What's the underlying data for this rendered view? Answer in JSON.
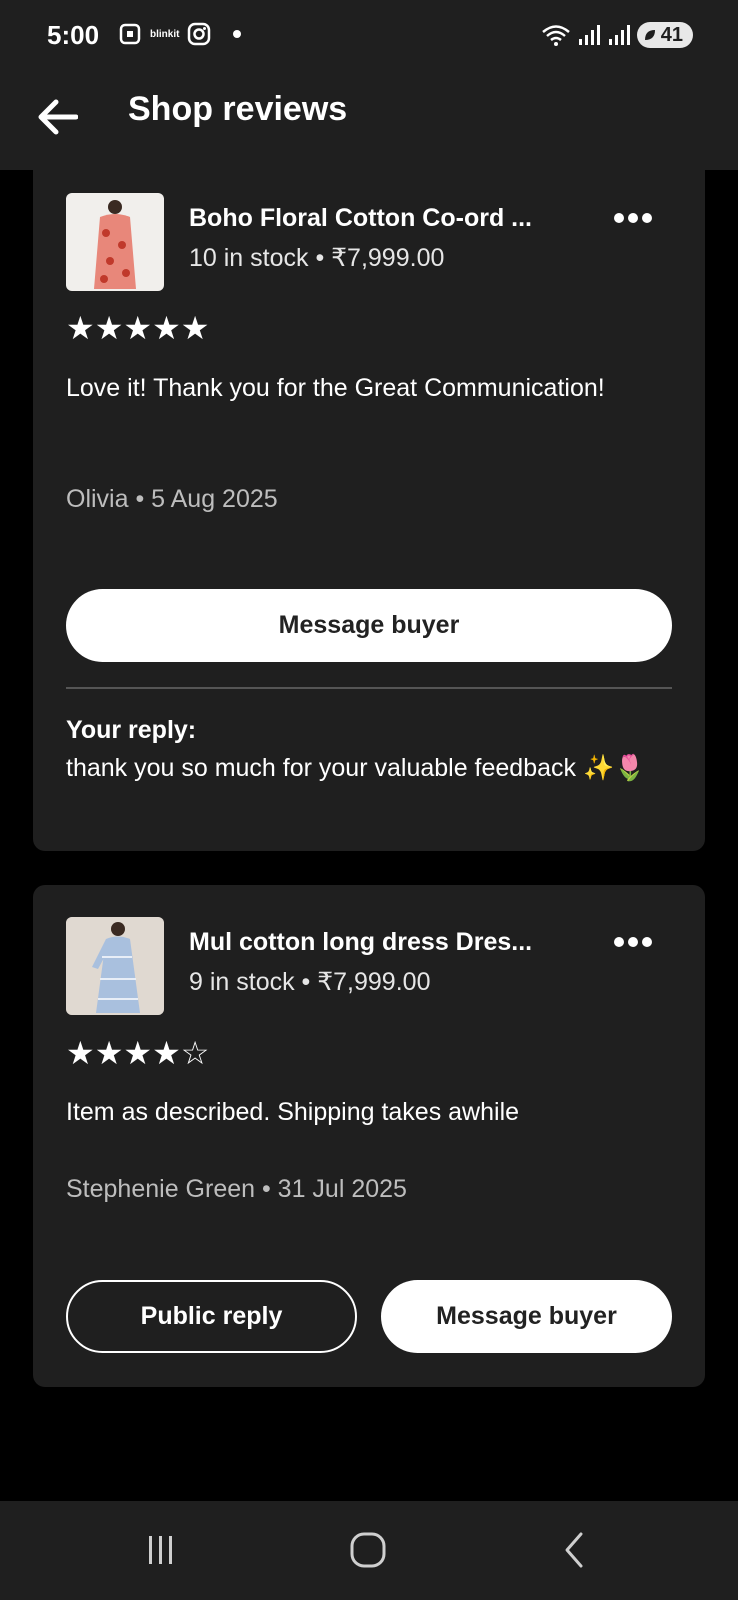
{
  "status_bar": {
    "time": "5:00",
    "blinkit": "blinkit",
    "battery": "41",
    "icons": [
      "screenshot-icon",
      "instagram-icon",
      "wifi-icon",
      "signal-icon",
      "signal-icon",
      "battery-saver-icon"
    ]
  },
  "app_bar": {
    "title": "Shop reviews",
    "back_icon": "arrow-left-icon"
  },
  "reviews": [
    {
      "product_title": "Boho Floral Cotton Co-ord ...",
      "product_meta": "10 in stock • ₹7,999.00",
      "rating": 5,
      "stars_text": "★★★★★",
      "text": "Love it! Thank you for the Great Communication!",
      "reviewer": "Olivia • 5 Aug 2025",
      "message_button": "Message buyer",
      "reply_label": "Your reply:",
      "reply_text": "thank you so much for your valuable  feedback ✨🌷"
    },
    {
      "product_title": "Mul cotton long dress Dres...",
      "product_meta": "9 in stock • ₹7,999.00",
      "rating": 4,
      "stars_text": "★★★★☆",
      "text": "Item as described.  Shipping takes awhile",
      "reviewer": "Stephenie Green • 31 Jul 2025",
      "public_reply_button": "Public reply",
      "message_button": "Message buyer"
    }
  ],
  "nav_bar": {
    "items": [
      "recent-apps-icon",
      "home-icon",
      "back-icon"
    ]
  }
}
